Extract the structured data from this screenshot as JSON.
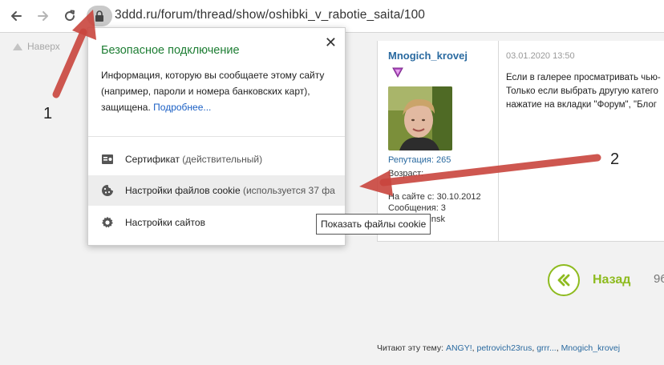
{
  "browser": {
    "url": "3ddd.ru/forum/thread/show/oshibki_v_rabotie_saita/100",
    "icons": [
      "back-icon",
      "forward-icon",
      "reload-icon",
      "lock-icon"
    ]
  },
  "page": {
    "scroll_top_label": "Наверх",
    "post": {
      "username": "Mnogich_krovej",
      "date": "03.01.2020 13:50",
      "reputation": "Репутация: 265",
      "age": "Возраст:",
      "on_site": "На сайте с: 30.10.2012",
      "messages": "Сообщения: 3",
      "from": "Откуда: Minsk",
      "text_lines": [
        "Если в галерее просматривать чью-",
        "Только если выбрать другую катего",
        "нажатие на вкладки \"Форум\", \"Блог"
      ]
    },
    "back_label": "Назад",
    "page_number": "96",
    "readers_label": "Читают эту тему:",
    "readers": [
      "ANGY!",
      "petrovich23rus",
      "grrr...",
      "Mnogich_krovej"
    ],
    "readers_separator": ","
  },
  "site_info_popup": {
    "title": "Безопасное подключение",
    "description": "Информация, которую вы сообщаете этому сайту (например, пароли и номера банковских карт), защищена.",
    "more_link": "Подробнее...",
    "items": [
      {
        "label": "Сертификат",
        "suffix": "(действительный)",
        "icon": "certificate-icon"
      },
      {
        "label": "Настройки файлов cookie",
        "suffix": "(используется 37 фа",
        "icon": "cookie-icon"
      },
      {
        "label": "Настройки сайтов",
        "suffix": "",
        "icon": "settings-gear-icon"
      }
    ],
    "tooltip": "Показать файлы cookie"
  },
  "annotations": {
    "label_1": "1",
    "label_2": "2",
    "arrow_color": "#c9453d"
  },
  "colors": {
    "popup_title_green": "#1e7e34",
    "link_blue": "#1a5fc4",
    "forum_blue": "#2a6aa0",
    "accent_lime": "#8ebb1f"
  }
}
